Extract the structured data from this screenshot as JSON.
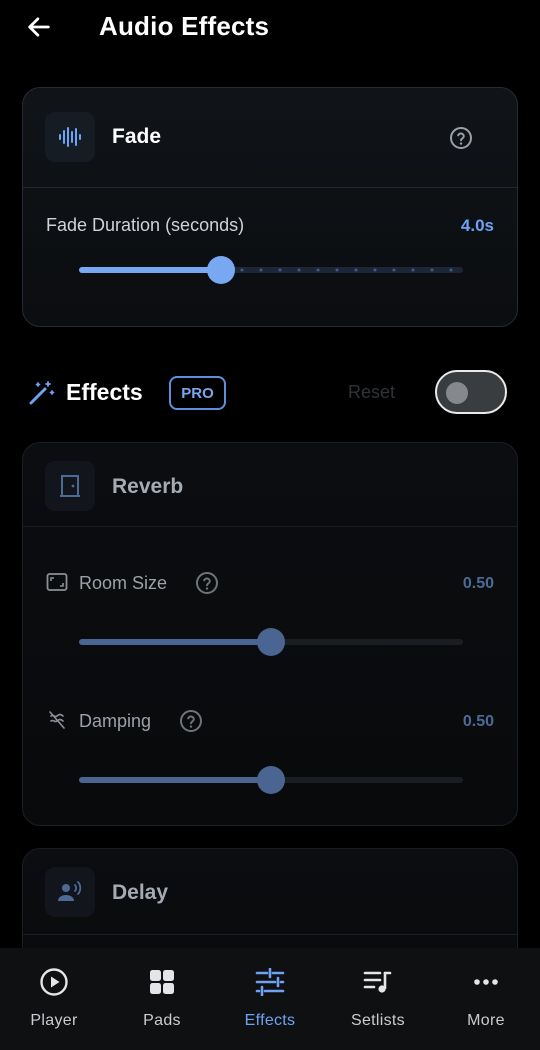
{
  "header": {
    "title": "Audio Effects"
  },
  "fade": {
    "title": "Fade",
    "duration_label": "Fade Duration (seconds)",
    "duration_value": "4.0s",
    "duration_fraction": 0.37
  },
  "effects": {
    "title": "Effects",
    "badge": "PRO",
    "reset_label": "Reset",
    "enabled": false
  },
  "reverb": {
    "title": "Reverb",
    "room_size_label": "Room Size",
    "room_size_value": "0.50",
    "damping_label": "Damping",
    "damping_value": "0.50"
  },
  "delay": {
    "title": "Delay"
  },
  "nav": {
    "player": "Player",
    "pads": "Pads",
    "effects": "Effects",
    "setlists": "Setlists",
    "more": "More",
    "active": "effects"
  },
  "colors": {
    "accent": "#6fa2f5",
    "background": "#000000",
    "card": "#0d1014"
  }
}
